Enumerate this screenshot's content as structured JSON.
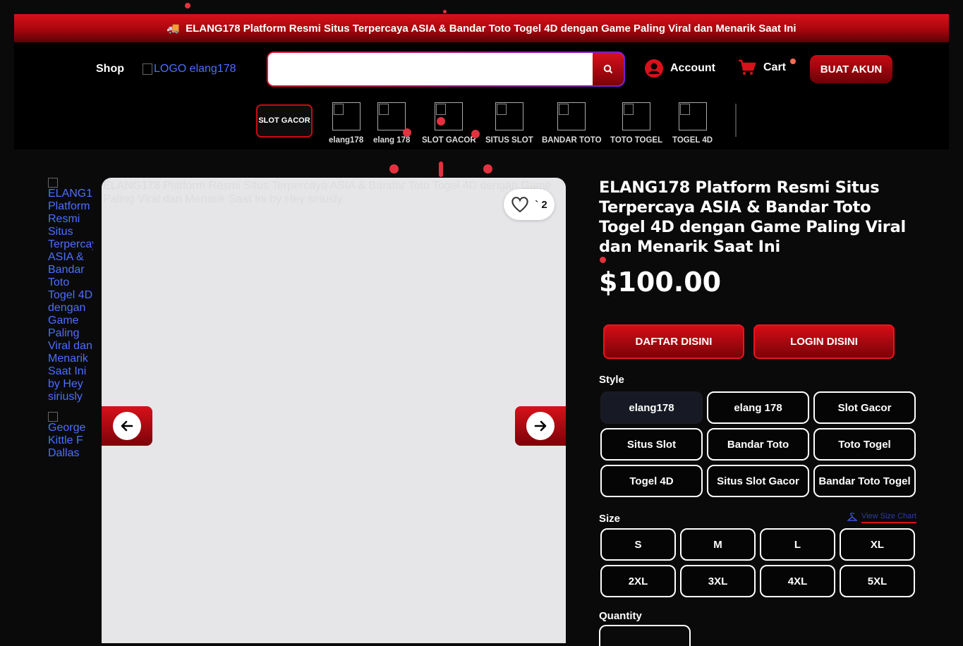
{
  "promo": {
    "text": "ELANG178 Platform Resmi Situs Terpercaya ASIA & Bandar Toto Togel 4D dengan Game Paling Viral dan Menarik Saat Ini",
    "icon": "truck-icon"
  },
  "header": {
    "shop": "Shop",
    "logo_alt": "LOGO elang178",
    "search": {
      "placeholder": "",
      "icon": "search-icon"
    },
    "account": "Account",
    "cart": "Cart",
    "register": "BUAT AKUN"
  },
  "nav": {
    "slot_gacor": "SLOT GACOR",
    "categories": [
      {
        "label": "elang178"
      },
      {
        "label": "elang 178"
      },
      {
        "label": "SLOT GACOR"
      },
      {
        "label": "SITUS SLOT"
      },
      {
        "label": "BANDAR TOTO"
      },
      {
        "label": "TOTO TOGEL"
      },
      {
        "label": "TOGEL 4D"
      }
    ]
  },
  "gallery": {
    "thumbs": [
      "ELANG178 Platform Resmi Situs Terpercaya ASIA & Bandar Toto Togel 4D dengan Game Paling Viral dan Menarik Saat Ini by Hey siriusly",
      "George Kittle F Dallas"
    ],
    "main_alt": "ELANG178 Platform Resmi Situs Terpercaya ASIA & Bandar Toto Togel 4D dengan Game Paling Viral dan Menarik Saat Ini by Hey siriusly",
    "likes": "` 2"
  },
  "product": {
    "title": "ELANG178 Platform Resmi Situs Terpercaya ASIA & Bandar Toto Togel 4D dengan Game Paling Viral dan Menarik Saat Ini",
    "price": "$100.00",
    "cta_register": "DAFTAR DISINI",
    "cta_login": "LOGIN DISINI",
    "style_label": "Style",
    "styles": [
      "elang178",
      "elang 178",
      "Slot Gacor",
      "Situs Slot",
      "Bandar Toto",
      "Toto Togel",
      "Togel 4D",
      "Situs Slot Gacor",
      "Bandar Toto Togel"
    ],
    "selected_style": "elang178",
    "size_label": "Size",
    "size_chart": "View Size Chart",
    "sizes": [
      "S",
      "M",
      "L",
      "XL",
      "2XL",
      "3XL",
      "4XL",
      "5XL"
    ],
    "quantity_label": "Quantity"
  },
  "colors": {
    "accent_red": "#d8111a",
    "link_blue": "#4c6fff"
  }
}
